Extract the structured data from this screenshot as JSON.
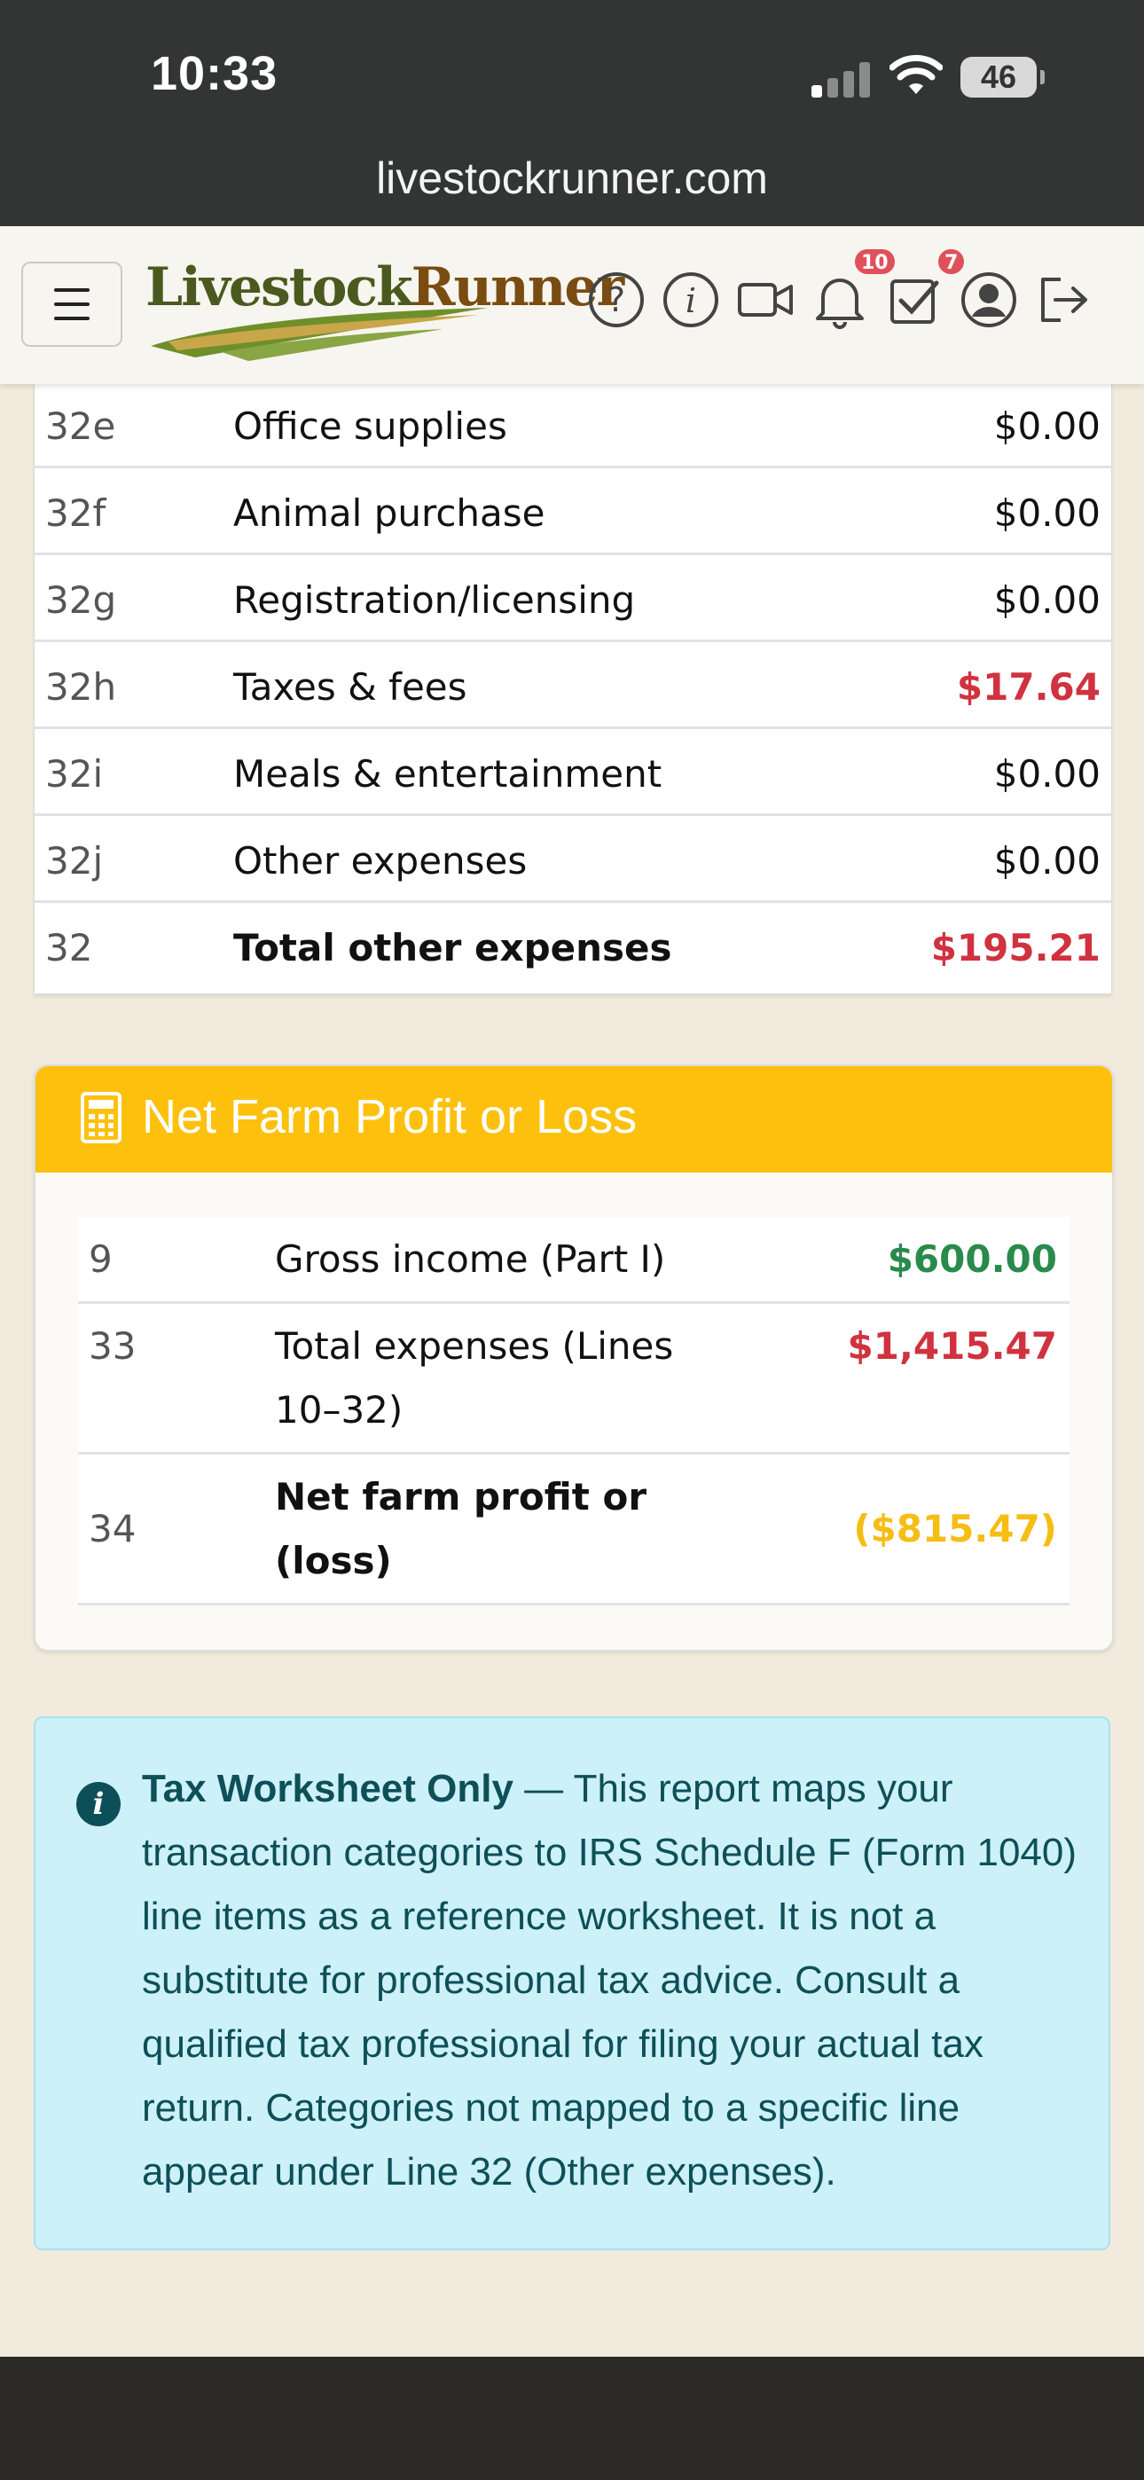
{
  "status_bar": {
    "time": "10:33",
    "battery": "46",
    "url": "livestockrunner.com"
  },
  "header": {
    "logo_text_a": "Livestock",
    "logo_text_b": "Runner",
    "notifications_badge": "10",
    "tasks_badge": "7",
    "icons": [
      "menu-icon",
      "help-icon",
      "info-icon",
      "video-icon",
      "bell-icon",
      "checkbox-icon",
      "user-icon",
      "logout-icon"
    ]
  },
  "other_expenses": {
    "rows": [
      {
        "line": "32e",
        "label": "Office supplies",
        "amount": "$0.00"
      },
      {
        "line": "32f",
        "label": "Animal purchase",
        "amount": "$0.00"
      },
      {
        "line": "32g",
        "label": "Registration/licensing",
        "amount": "$0.00"
      },
      {
        "line": "32h",
        "label": "Taxes & fees",
        "amount": "$17.64"
      },
      {
        "line": "32i",
        "label": "Meals & entertainment",
        "amount": "$0.00"
      },
      {
        "line": "32j",
        "label": "Other expenses",
        "amount": "$0.00"
      },
      {
        "line": "32",
        "label": "Total other expenses",
        "amount": "$195.21"
      }
    ]
  },
  "net_farm": {
    "title": "Net Farm Profit or Loss",
    "rows": [
      {
        "line": "9",
        "label": "Gross income (Part I)",
        "amount": "$600.00"
      },
      {
        "line": "33",
        "label": "Total expenses (Lines 10–32)",
        "amount": "$1,415.47"
      },
      {
        "line": "34",
        "label": "Net farm profit or (loss)",
        "amount": "($815.47)"
      }
    ]
  },
  "notice": {
    "bold": "Tax Worksheet Only",
    "text": " — This report maps your transaction categories to IRS Schedule F (Form 1040) line items as a reference worksheet. It is not a substitute for professional tax advice. Consult a qualified tax professional for filing your actual tax return. Categories not mapped to a specific line appear under Line 32 (Other expenses)."
  },
  "colors": {
    "accent_yellow": "#fdc10d",
    "negative": "#d0323f",
    "positive": "#2a8a4c",
    "info_bg": "#cdf1f8"
  }
}
